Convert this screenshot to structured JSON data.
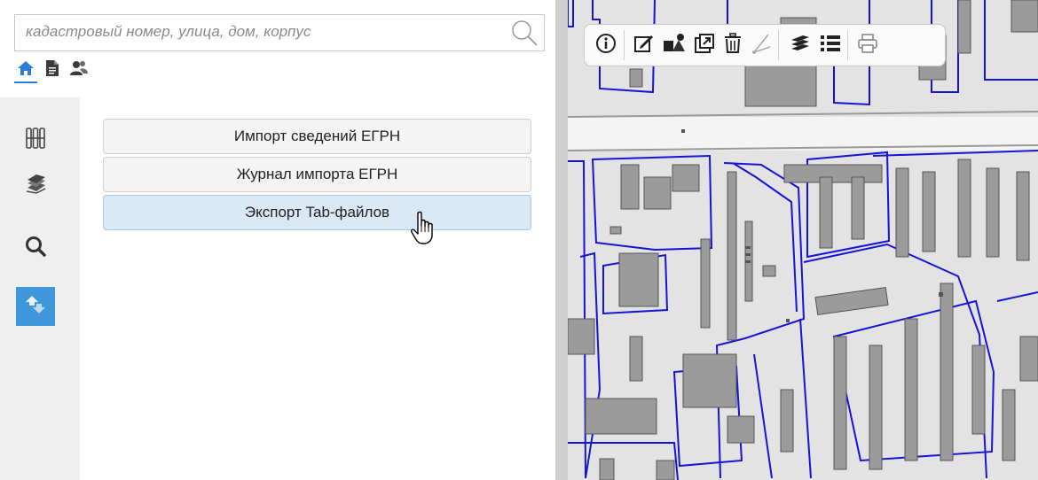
{
  "search": {
    "placeholder": "кадастровый номер, улица, дом, корпус",
    "value": ""
  },
  "mode_tabs": [
    {
      "icon": "home-icon",
      "active": true
    },
    {
      "icon": "document-icon",
      "active": false
    },
    {
      "icon": "users-icon",
      "active": false
    }
  ],
  "sidebar": {
    "items": [
      {
        "icon": "grid-icon",
        "active": false
      },
      {
        "icon": "layers-icon",
        "active": false
      },
      {
        "icon": "search-icon",
        "active": true
      },
      {
        "icon": "transfer-icon",
        "active": true
      }
    ]
  },
  "actions": [
    {
      "label": "Импорт сведений ЕГРН",
      "selected": false
    },
    {
      "label": "Журнал импорта ЕГРН",
      "selected": false
    },
    {
      "label": "Экспорт Tab-файлов",
      "selected": true
    }
  ],
  "map_toolbar": {
    "tools": [
      "info-icon",
      "edit-icon",
      "shapes-icon",
      "open-window-icon",
      "trash-icon",
      "measure-icon",
      "layers-icon",
      "list-icon",
      "print-icon"
    ]
  },
  "colors": {
    "accent": "#3f97db",
    "selected_bg": "#d8e8f5",
    "parcel_line": "#1010d0",
    "building": "#9b9b9b"
  }
}
